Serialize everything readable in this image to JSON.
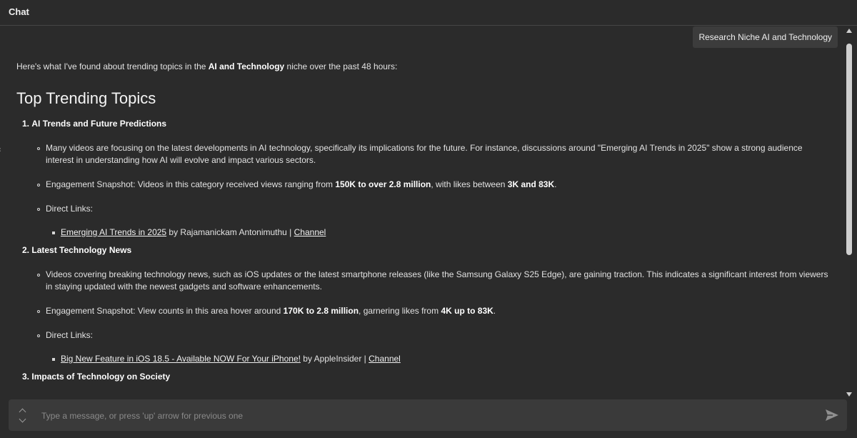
{
  "header": {
    "title": "Chat"
  },
  "user_message": "Research Niche AI and Technology",
  "assistant": {
    "intro_pre": "Here's what I've found about trending topics in the ",
    "intro_bold": "AI and Technology",
    "intro_post": " niche over the past 48 hours:",
    "heading": "Top Trending Topics",
    "topics": [
      {
        "num": "1.",
        "title": "AI Trends and Future Predictions",
        "desc_line1": "Many videos are focusing on the latest developments in AI technology, specifically its implications for the future. For instance, discussions around \"Emerging AI Trends in 2025\" show a strong audience",
        "desc_line2": "interest in understanding how AI will evolve and impact various sectors.",
        "eng_pre": "Engagement Snapshot: Videos in this category received views ranging from ",
        "eng_b1": "150K to over 2.8 million",
        "eng_mid": ", with likes between ",
        "eng_b2": "3K and 83K",
        "eng_post": ".",
        "links_label": "Direct Links:",
        "link_title": "Emerging AI Trends in 2025",
        "link_by": " by Rajamanickam Antonimuthu | ",
        "link_channel": "Channel"
      },
      {
        "num": "2.",
        "title": "Latest Technology News",
        "desc_line1": "Videos covering breaking technology news, such as iOS updates or the latest smartphone releases (like the Samsung Galaxy S25 Edge), are gaining traction. This indicates a significant interest from viewers",
        "desc_line2": "in staying updated with the newest gadgets and software enhancements.",
        "eng_pre": "Engagement Snapshot: View counts in this area hover around ",
        "eng_b1": "170K to 2.8 million",
        "eng_mid": ", garnering likes from ",
        "eng_b2": "4K up to 83K",
        "eng_post": ".",
        "links_label": "Direct Links:",
        "link_title": "Big New Feature in iOS 18.5 - Available NOW For Your iPhone!",
        "link_by": " by AppleInsider | ",
        "link_channel": "Channel"
      },
      {
        "num": "3.",
        "title": "Impacts of Technology on Society"
      }
    ]
  },
  "composer": {
    "placeholder": "Type a message, or press 'up' arrow for previous one"
  },
  "icons": {
    "send": "send-icon",
    "history": "history-arrows-icon"
  }
}
